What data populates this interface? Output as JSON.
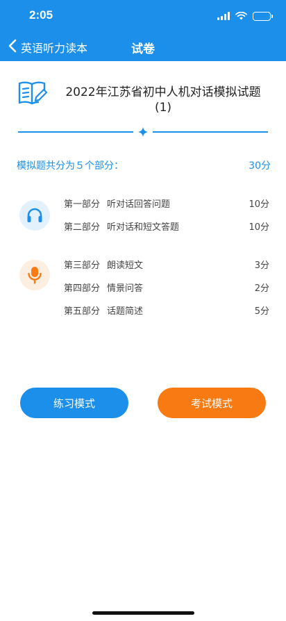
{
  "status_bar": {
    "time": "2:05"
  },
  "nav": {
    "back_label": "英语听力读本",
    "title": "试卷"
  },
  "paper": {
    "title_line1": "2022年江苏省初中人机对话模拟试题",
    "title_line2": "(1)"
  },
  "summary": {
    "text": "模拟题共分为５个部分：",
    "total_score": "30分"
  },
  "groups": [
    {
      "icon": "headphones-icon",
      "parts": [
        {
          "label": "第一部分",
          "name": "听对话回答问题",
          "score": "10分"
        },
        {
          "label": "第二部分",
          "name": "听对话和短文答题",
          "score": "10分"
        }
      ]
    },
    {
      "icon": "microphone-icon",
      "parts": [
        {
          "label": "第三部分",
          "name": "朗读短文",
          "score": "3分"
        },
        {
          "label": "第四部分",
          "name": "情景问答",
          "score": "2分"
        },
        {
          "label": "第五部分",
          "name": "话题简述",
          "score": "5分"
        }
      ]
    }
  ],
  "buttons": {
    "practice": "练习模式",
    "exam": "考试模式"
  },
  "colors": {
    "primary": "#1b8fe9",
    "accent": "#f87a12"
  }
}
